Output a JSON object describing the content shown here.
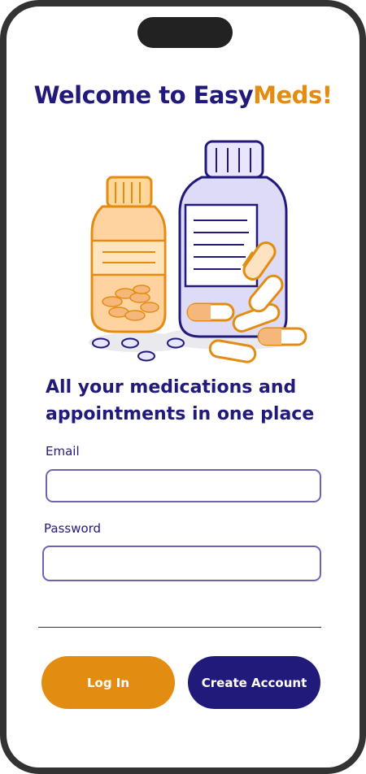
{
  "header": {
    "title_prefix": "Welcome to Easy",
    "title_accent": "Meds!"
  },
  "tagline": "All your medications and appointments in one place",
  "form": {
    "email_label": "Email",
    "email_value": "",
    "password_label": "Password",
    "password_value": ""
  },
  "buttons": {
    "login_label": "Log In",
    "create_label": "Create Account"
  },
  "colors": {
    "primary": "#211a7a",
    "accent": "#e38c12",
    "input_border": "#6f63b3",
    "frame": "#333333"
  },
  "icons": {
    "illustration": "medicine-bottles-illustration",
    "notch": "phone-notch"
  }
}
